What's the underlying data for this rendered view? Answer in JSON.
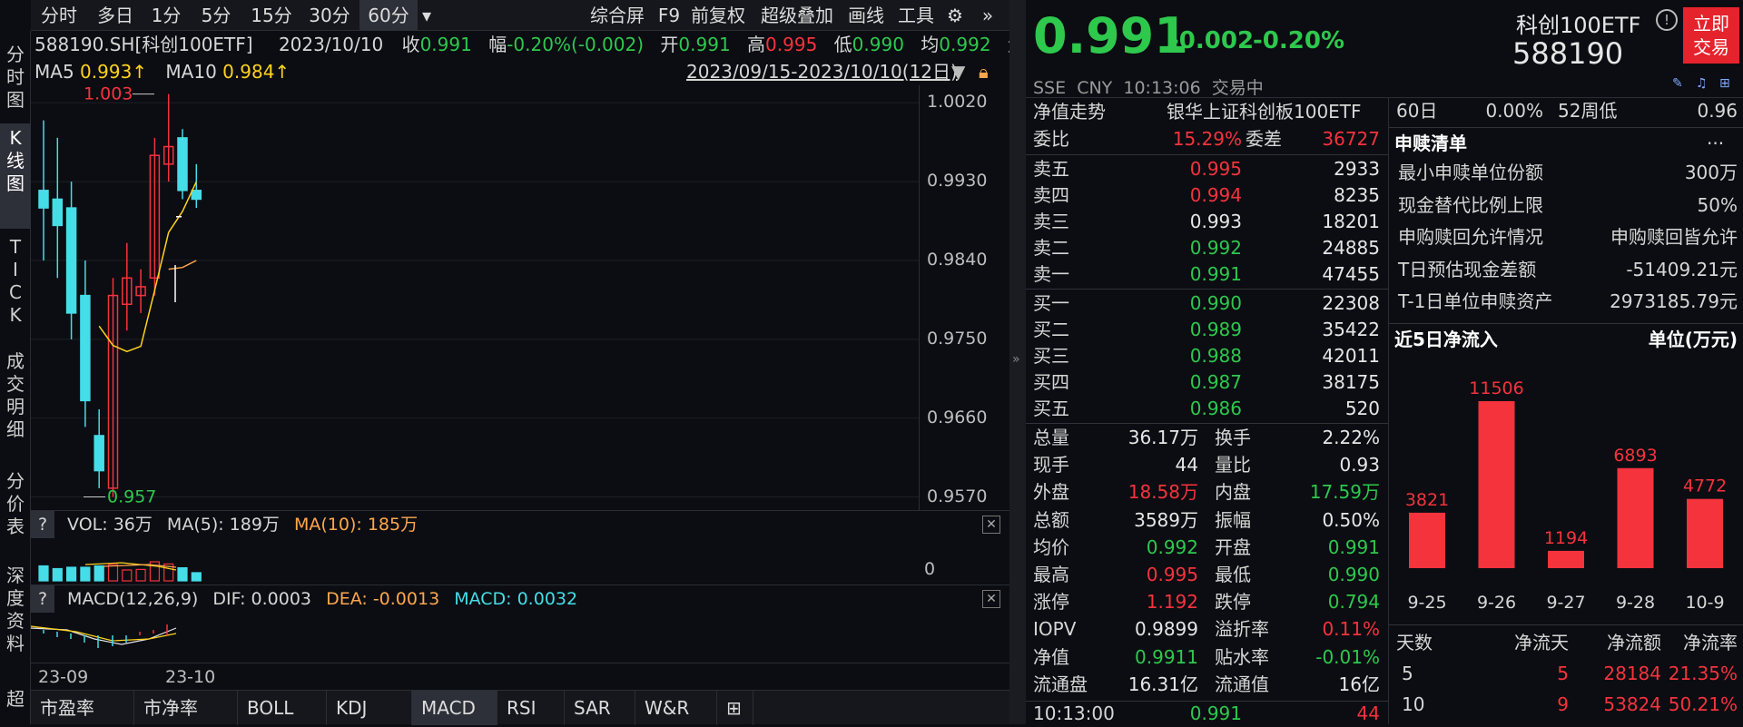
{
  "toolbar": {
    "items": [
      "分时",
      "多日",
      "1分",
      "5分",
      "15分",
      "30分",
      "60分",
      "▾"
    ],
    "right": [
      "综合屏",
      "F9",
      "前复权",
      "超级叠加",
      "画线",
      "工具"
    ]
  },
  "vtabs": [
    "分\n时\n图",
    "K\n线\n图",
    "T\nI\nC\nK",
    "成\n交\n明\n细",
    "分\n价\n表",
    "深\n度\n资\n料",
    "超"
  ],
  "info": {
    "code": "588190.SH[科创100ETF]",
    "date": "2023/10/10",
    "close_l": "收",
    "close": "0.991",
    "amp_l": "幅",
    "amp": "-0.20%(-0.002)",
    "open_l": "开",
    "open": "0.991",
    "high_l": "高",
    "high": "0.995",
    "low_l": "低",
    "low": "0.990",
    "avg_l": "均",
    "avg": "0.992",
    "vol_l": "量"
  },
  "ma": {
    "ma5_l": "MA5",
    "ma5": "0.993↑",
    "ma10_l": "MA10",
    "ma10": "0.984↑",
    "range": "2023/09/15-2023/10/10(12日)"
  },
  "kchart": {
    "ylabels": [
      "1.0020",
      "0.9930",
      "0.9840",
      "0.9750",
      "0.9660",
      "0.9570"
    ],
    "yvals": [
      1.002,
      0.993,
      0.984,
      0.975,
      0.966,
      0.957
    ],
    "hi_label": "1.003",
    "lo_label": "0.957",
    "candles": [
      {
        "o": 0.992,
        "c": 0.99,
        "h": 1.0,
        "l": 0.984
      },
      {
        "o": 0.991,
        "c": 0.988,
        "h": 0.998,
        "l": 0.982
      },
      {
        "o": 0.99,
        "c": 0.978,
        "h": 0.993,
        "l": 0.975
      },
      {
        "o": 0.98,
        "c": 0.968,
        "h": 0.984,
        "l": 0.965
      },
      {
        "o": 0.964,
        "c": 0.96,
        "h": 0.967,
        "l": 0.958
      },
      {
        "o": 0.958,
        "c": 0.98,
        "h": 0.982,
        "l": 0.957
      },
      {
        "o": 0.979,
        "c": 0.982,
        "h": 0.986,
        "l": 0.976
      },
      {
        "o": 0.98,
        "c": 0.981,
        "h": 0.983,
        "l": 0.978
      },
      {
        "o": 0.982,
        "c": 0.996,
        "h": 0.998,
        "l": 0.98
      },
      {
        "o": 0.995,
        "c": 0.997,
        "h": 1.003,
        "l": 0.993
      },
      {
        "o": 0.998,
        "c": 0.992,
        "h": 0.999,
        "l": 0.991
      },
      {
        "o": 0.992,
        "c": 0.991,
        "h": 0.995,
        "l": 0.99
      }
    ],
    "ma5": [
      null,
      null,
      null,
      null,
      0.9765,
      0.9743,
      0.9736,
      0.9742,
      0.9806,
      0.9872,
      0.9896,
      0.993
    ],
    "ma10": [
      null,
      null,
      null,
      null,
      null,
      null,
      null,
      null,
      null,
      0.983,
      0.9832,
      0.984
    ]
  },
  "vol": {
    "q": "?",
    "label": "VOL: 36万",
    "ma5": "MA(5): 189万",
    "ma10": "MA(10): 185万",
    "zero": "0"
  },
  "macd": {
    "q": "?",
    "label": "MACD(12,26,9)",
    "dif": "DIF: 0.0003",
    "dea": "DEA: -0.0013",
    "macd": "MACD: 0.0032"
  },
  "xaxis": [
    "23-09",
    "23-10"
  ],
  "bottom_tabs": [
    "市盈率",
    "市净率",
    "BOLL",
    "KDJ",
    "MACD",
    "RSI",
    "SAR",
    "W&R",
    "⊞"
  ],
  "quote": {
    "price": "0.991",
    "chg": "-0.002",
    "pct": "-0.20%",
    "name": "科创100ETF",
    "code": "588190",
    "trade_btn": "立即\n交易",
    "market": "SSE  CNY  10:13:06  交易中"
  },
  "obook": {
    "nav_l": "净值走势",
    "nav_name": "银华上证科创板100ETF",
    "wb_l": "委比",
    "wb": "15.29%",
    "wc_l": "委差",
    "wc": "36727",
    "asks": [
      [
        "卖五",
        "0.995",
        "2933",
        "red"
      ],
      [
        "卖四",
        "0.994",
        "8235",
        "red"
      ],
      [
        "卖三",
        "0.993",
        "18201",
        "white"
      ],
      [
        "卖二",
        "0.992",
        "24885",
        "green"
      ],
      [
        "卖一",
        "0.991",
        "47455",
        "green"
      ]
    ],
    "bids": [
      [
        "买一",
        "0.990",
        "22308",
        "green"
      ],
      [
        "买二",
        "0.989",
        "35422",
        "green"
      ],
      [
        "买三",
        "0.988",
        "42011",
        "green"
      ],
      [
        "买四",
        "0.987",
        "38175",
        "green"
      ],
      [
        "买五",
        "0.986",
        "520",
        "green"
      ]
    ],
    "stats": [
      [
        "总量",
        "36.17万",
        "white",
        "换手",
        "2.22%",
        "white"
      ],
      [
        "现手",
        "44",
        "white",
        "量比",
        "0.93",
        "white"
      ],
      [
        "外盘",
        "18.58万",
        "red",
        "内盘",
        "17.59万",
        "green"
      ],
      [
        "总额",
        "3589万",
        "white",
        "振幅",
        "0.50%",
        "white"
      ],
      [
        "均价",
        "0.992",
        "green",
        "开盘",
        "0.991",
        "green"
      ],
      [
        "最高",
        "0.995",
        "red",
        "最低",
        "0.990",
        "green"
      ],
      [
        "涨停",
        "1.192",
        "red",
        "跌停",
        "0.794",
        "green"
      ],
      [
        "IOPV",
        "0.9899",
        "white",
        "溢折率",
        "0.11%",
        "red"
      ],
      [
        "净值",
        "0.9911",
        "green",
        "贴水率",
        "-0.01%",
        "green"
      ],
      [
        "流通盘",
        "16.31亿",
        "white",
        "流通值",
        "16亿",
        "white"
      ]
    ],
    "last_time": "10:13:00",
    "last_price": "0.991",
    "last_vol": "44"
  },
  "info_panel": {
    "top_row": [
      "60日",
      "0.00%",
      "52周低",
      "0.96"
    ],
    "sg_title": "申赎清单",
    "sg_more": "···",
    "sg": [
      [
        "最小申赎单位份额",
        "300万"
      ],
      [
        "现金替代比例上限",
        "50%"
      ],
      [
        "申购赎回允许情况",
        "申购赎回皆允许"
      ],
      [
        "T日预估现金差额",
        "-51409.21元"
      ],
      [
        "T-1日单位申赎资产",
        "2973185.79元"
      ]
    ],
    "flow_title": "近5日净流入",
    "flow_unit": "单位(万元)"
  },
  "chart_data": {
    "type": "bar",
    "title": "近5日净流入",
    "ylabel": "单位(万元)",
    "categories": [
      "9-25",
      "9-26",
      "9-27",
      "9-28",
      "10-9"
    ],
    "values": [
      3821,
      11506,
      1194,
      6893,
      4772
    ],
    "ylim": [
      0,
      11506
    ]
  },
  "summary": {
    "headers": [
      "天数",
      "净流天",
      "净流额",
      "净流率"
    ],
    "rows": [
      [
        "5",
        "5",
        "28184",
        "21.35%"
      ],
      [
        "10",
        "9",
        "53824",
        "50.21%"
      ]
    ]
  }
}
